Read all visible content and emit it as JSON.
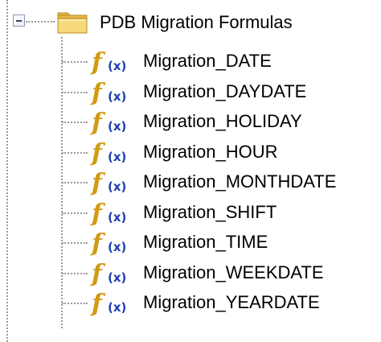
{
  "tree": {
    "root": {
      "label": "PDB Migration Formulas",
      "icon": "folder-icon",
      "expanded": true
    },
    "items": [
      {
        "label": "Migration_DATE",
        "icon": "formula-icon"
      },
      {
        "label": "Migration_DAYDATE",
        "icon": "formula-icon"
      },
      {
        "label": "Migration_HOLIDAY",
        "icon": "formula-icon"
      },
      {
        "label": "Migration_HOUR",
        "icon": "formula-icon"
      },
      {
        "label": "Migration_MONTHDATE",
        "icon": "formula-icon"
      },
      {
        "label": "Migration_SHIFT",
        "icon": "formula-icon"
      },
      {
        "label": "Migration_TIME",
        "icon": "formula-icon"
      },
      {
        "label": "Migration_WEEKDATE",
        "icon": "formula-icon"
      },
      {
        "label": "Migration_YEARDATE",
        "icon": "formula-icon"
      }
    ]
  },
  "colors": {
    "formula_f": "#d29a14",
    "formula_brackets": "#1d3fb0",
    "folder": "#f3d270",
    "connector": "#9a9a9a"
  }
}
